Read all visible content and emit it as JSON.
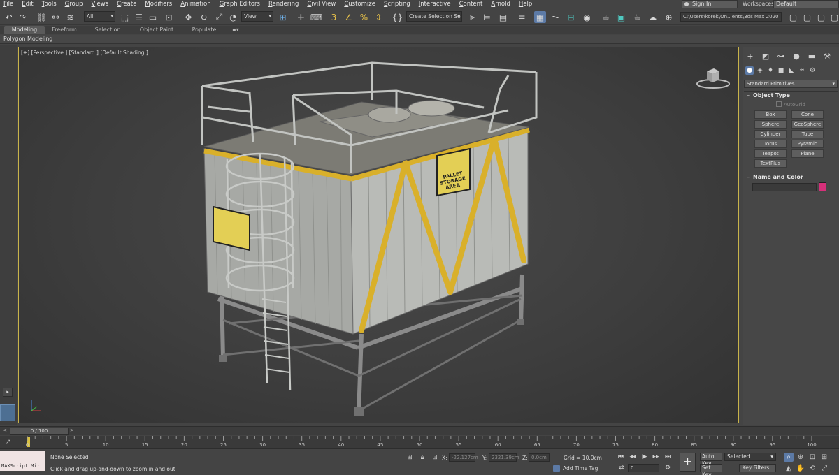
{
  "menubar": {
    "items": [
      "File",
      "Edit",
      "Tools",
      "Group",
      "Views",
      "Create",
      "Modifiers",
      "Animation",
      "Graph Editors",
      "Rendering",
      "Civil View",
      "Customize",
      "Scripting",
      "Interactive",
      "Content",
      "Arnold",
      "Help"
    ],
    "sign_in": "Sign In",
    "workspaces_label": "Workspaces:",
    "workspace_value": "Default"
  },
  "toolbar": {
    "selection_filter": "All",
    "reference_coord": "View",
    "named_selection": "Create Selection Se",
    "project_path": "C:\\Users\\korek\\On...ents\\3ds Max 2020"
  },
  "ribbon": {
    "tabs": [
      "Modeling",
      "Freeform",
      "Selection",
      "Object Paint",
      "Populate"
    ],
    "active_tab": "Modeling",
    "panel_label": "Polygon Modeling"
  },
  "viewport": {
    "label": "[+] [Perspective ] [Standard ] [Default Shading ]",
    "sign_text": "PALLET STORAGE AREA"
  },
  "command_panel": {
    "category": "Standard Primitives",
    "object_type_title": "Object Type",
    "autogrid": "AutoGrid",
    "primitives": [
      "Box",
      "Cone",
      "Sphere",
      "GeoSphere",
      "Cylinder",
      "Tube",
      "Torus",
      "Pyramid",
      "Teapot",
      "Plane",
      "TextPlus"
    ],
    "name_color_title": "Name and Color",
    "object_color": "#d6307a"
  },
  "time_slider": {
    "left_arrow": "<",
    "position": "0 / 100",
    "right_arrow": ">"
  },
  "trackbar": {
    "ticks": [
      "0",
      "5",
      "10",
      "15",
      "20",
      "25",
      "30",
      "35",
      "40",
      "45",
      "50",
      "55",
      "60",
      "65",
      "70",
      "75",
      "80",
      "85",
      "90",
      "95",
      "100"
    ]
  },
  "status": {
    "maxscript": "MAXScript Mi:",
    "selection": "None Selected",
    "prompt": "Click and drag up-and-down to zoom in and out",
    "x_label": "X:",
    "x_value": "-22.127cm",
    "y_label": "Y:",
    "y_value": "2321.39cm",
    "z_label": "Z:",
    "z_value": "0.0cm",
    "grid": "Grid = 10.0cm",
    "add_time_tag": "Add Time Tag",
    "current_frame": "0",
    "auto_key": "Auto Key",
    "auto_key_mode": "Selected",
    "set_key": "Set Key",
    "key_filters": "Key Filters..."
  },
  "colors": {
    "viewport_border": "#c8b34a",
    "accent_blue": "#5c7aa6",
    "railing_yellow": "#d9b02a",
    "timeline_marker": "#d8c040"
  }
}
